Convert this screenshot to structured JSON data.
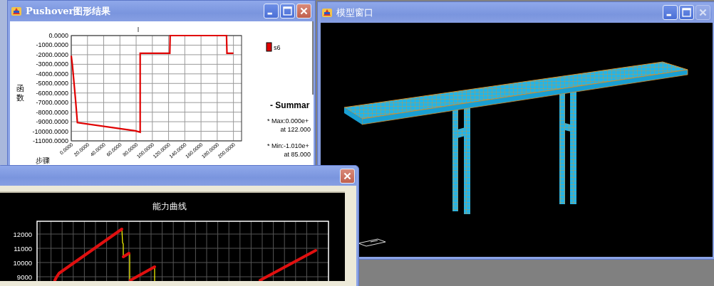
{
  "pushover_window": {
    "title": "Pushover图形结果",
    "buttons": [
      {
        "kind": "minimize",
        "disabled": false
      },
      {
        "kind": "maximize",
        "disabled": false
      },
      {
        "kind": "close",
        "disabled": false
      }
    ],
    "chart_data": {
      "type": "line",
      "grid": true,
      "title": "l",
      "xlabel": "步骤",
      "ylabel": "函数",
      "xlim": [
        0,
        210
      ],
      "ylim": [
        -11000,
        0
      ],
      "xticks": [
        {
          "value": 0,
          "label": "0.0000"
        },
        {
          "value": 20,
          "label": "20.0000"
        },
        {
          "value": 40,
          "label": "40.0000"
        },
        {
          "value": 60,
          "label": "60.0000"
        },
        {
          "value": 80,
          "label": "80.0000"
        },
        {
          "value": 100,
          "label": "100.0000"
        },
        {
          "value": 120,
          "label": "120.0000"
        },
        {
          "value": 140,
          "label": "140.0000"
        },
        {
          "value": 160,
          "label": "160.0000"
        },
        {
          "value": 180,
          "label": "180.0000"
        },
        {
          "value": 200,
          "label": "200.0000"
        }
      ],
      "yticks": [
        {
          "value": 0,
          "label": "0.0000"
        },
        {
          "value": -1000,
          "label": "-1000.0000"
        },
        {
          "value": -2000,
          "label": "-2000.0000"
        },
        {
          "value": -3000,
          "label": "-3000.0000"
        },
        {
          "value": -4000,
          "label": "-4000.0000"
        },
        {
          "value": -5000,
          "label": "-5000.0000"
        },
        {
          "value": -6000,
          "label": "-6000.0000"
        },
        {
          "value": -7000,
          "label": "-7000.0000"
        },
        {
          "value": -8000,
          "label": "-8000.0000"
        },
        {
          "value": -9000,
          "label": "-9000.0000"
        },
        {
          "value": -10000,
          "label": "-10000.0000"
        },
        {
          "value": -11000,
          "label": "-11000.0000"
        }
      ],
      "x": [
        0,
        1.5,
        5.3,
        7.6,
        79,
        85,
        85,
        121.5,
        122,
        191.5,
        192,
        200
      ],
      "series": [
        {
          "name": "s6",
          "color": "#e00000",
          "values": [
            -2100,
            -3150,
            -6700,
            -9100,
            -9950,
            -10100,
            -1850,
            -1850,
            0,
            0,
            -1850,
            -1850
          ]
        }
      ]
    },
    "summary": {
      "heading": "- Summar",
      "lines": [
        "* Max:0.000e+",
        "at 122.000",
        "* Min:-1.010e+",
        "at 85.000"
      ]
    }
  },
  "model_window": {
    "title": "模型窗口",
    "buttons": [
      {
        "kind": "minimize",
        "disabled": false
      },
      {
        "kind": "maximize",
        "disabled": false
      },
      {
        "kind": "close",
        "disabled": true
      }
    ]
  },
  "capacity_window": {
    "buttons": [
      {
        "kind": "close",
        "disabled": false
      }
    ],
    "chart_title": "能力曲线",
    "y_tick_labels": [
      "12000",
      "11000",
      "10000",
      "9000"
    ]
  }
}
